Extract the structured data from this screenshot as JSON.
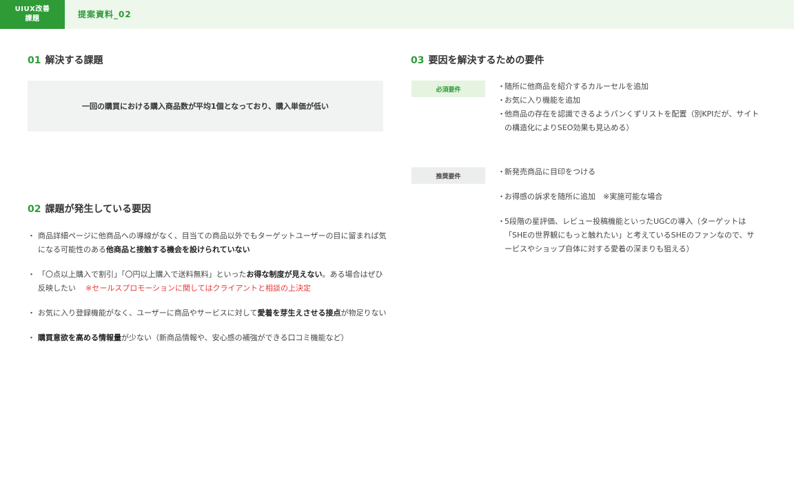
{
  "header": {
    "badge_line1": "UIUX改善",
    "badge_line2": "課題",
    "title": "提案資料_02"
  },
  "section1": {
    "num": "01",
    "title": "解決する課題",
    "issue": "一回の購買における購入商品数が平均1個となっており、購入単価が低い"
  },
  "section2": {
    "num": "02",
    "title": "課題が発生している要因",
    "items": [
      {
        "pre": "商品詳細ページに他商品への導線がなく、目当ての商品以外でもターゲットユーザーの目に留まれば気になる可能性のある",
        "bold": "他商品と接触する機会を設けられていない",
        "post": ""
      },
      {
        "pre": "「〇点以上購入で割引」「〇円以上購入で送料無料」といった",
        "bold": "お得な制度が見えない",
        "post": "。ある場合はぜひ反映したい",
        "note": "※セールスプロモーションに関してはクライアントと相談の上決定"
      },
      {
        "pre": "お気に入り登録機能がなく、ユーザーに商品やサービスに対して",
        "bold": "愛着を芽生えさせる接点",
        "post": "が物足りない"
      },
      {
        "pre": "",
        "bold": "購買意欲を高める情報量",
        "post": "が少ない（新商品情報や、安心感の補強ができる口コミ機能など）"
      }
    ]
  },
  "section3": {
    "num": "03",
    "title": "要因を解決するための要件",
    "must": {
      "label": "必須要件",
      "items": [
        "随所に他商品を紹介するカルーセルを追加",
        "お気に入り機能を追加",
        "他商品の存在を認識できるようパンくずリストを配置（別KPIだが、サイトの構造化によりSEO効果も見込める）"
      ]
    },
    "recommended": {
      "label": "推奨要件",
      "items": [
        "新発売商品に目印をつける",
        "お得感の訴求を随所に追加　※実施可能な場合",
        "5段階の星評価、レビュー投稿機能といったUGCの導入（ターゲットは「SHEの世界観にもっと触れたい」と考えているSHEのファンなので、サービスやショップ自体に対する愛着の深まりも狙える）"
      ]
    }
  },
  "colors": {
    "accent": "#2e9b37",
    "header_bg": "#eef7ec",
    "note_red": "#e53935"
  }
}
